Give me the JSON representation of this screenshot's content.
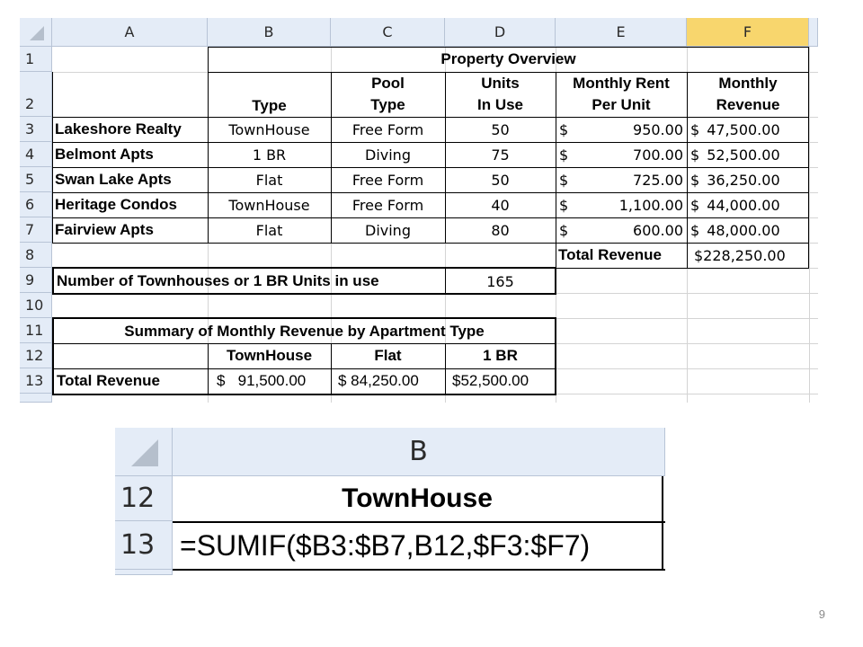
{
  "sheet1": {
    "columns": [
      "A",
      "B",
      "C",
      "D",
      "E",
      "F"
    ],
    "rows": [
      "1",
      "2",
      "3",
      "4",
      "5",
      "6",
      "7",
      "8",
      "9",
      "10",
      "11",
      "12",
      "13"
    ],
    "title": "Property Overview",
    "headers": {
      "type": "Type",
      "pool_1": "Pool",
      "pool_2": "Type",
      "units_1": "Units",
      "units_2": "In Use",
      "rent_1": "Monthly Rent",
      "rent_2": "Per Unit",
      "rev_1": "Monthly",
      "rev_2": "Revenue"
    },
    "properties": [
      {
        "name": "Lakeshore Realty",
        "type": "TownHouse",
        "pool": "Free Form",
        "units": "50",
        "rent_sym": "$",
        "rent": "950.00",
        "rev_sym": "$",
        "rev": "47,500.00"
      },
      {
        "name": "Belmont Apts",
        "type": "1 BR",
        "pool": "Diving",
        "units": "75",
        "rent_sym": "$",
        "rent": "700.00",
        "rev_sym": "$",
        "rev": "52,500.00"
      },
      {
        "name": "Swan Lake Apts",
        "type": "Flat",
        "pool": "Free Form",
        "units": "50",
        "rent_sym": "$",
        "rent": "725.00",
        "rev_sym": "$",
        "rev": "36,250.00"
      },
      {
        "name": "Heritage Condos",
        "type": "TownHouse",
        "pool": "Free Form",
        "units": "40",
        "rent_sym": "$",
        "rent": "1,100.00",
        "rev_sym": "$",
        "rev": "44,000.00"
      },
      {
        "name": "Fairview Apts",
        "type": "Flat",
        "pool": "Diving",
        "units": "80",
        "rent_sym": "$",
        "rent": "600.00",
        "rev_sym": "$",
        "rev": "48,000.00"
      }
    ],
    "total_label": "Total Revenue",
    "total_value": "$228,250.00",
    "count_label": "Number of Townhouses or 1 BR Units in use",
    "count_value": "165",
    "summary_title": "Summary of Monthly Revenue by Apartment Type",
    "summary_headers": [
      "TownHouse",
      "Flat",
      "1 BR"
    ],
    "summary_row_label": "Total Revenue",
    "summary_values": [
      "$   91,500.00",
      "$ 84,250.00",
      "$52,500.00"
    ]
  },
  "zoom": {
    "column": "B",
    "row_12": "12",
    "row_13": "13",
    "cell_b12": "TownHouse",
    "formula": "=SUMIF($B3:$B7,B12,$F3:$F7)"
  },
  "slide_number": "9"
}
